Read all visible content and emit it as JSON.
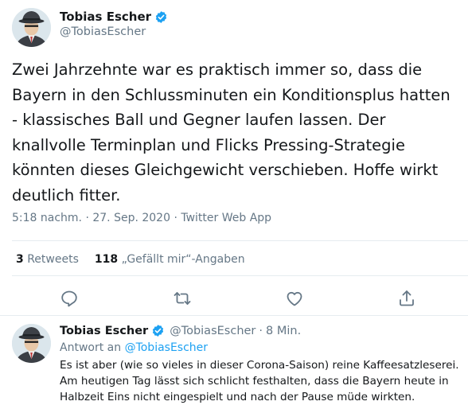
{
  "main_tweet": {
    "display_name": "Tobias Escher",
    "handle": "@TobiasEscher",
    "text": "Zwei Jahrzehnte war es praktisch immer so, dass die Bayern in den Schlussminuten ein Konditionsplus hatten - klassisches Ball und Gegner laufen lassen. Der knallvolle Terminplan und Flicks Pressing-Strategie könnten dieses Gleichgewicht verschieben. Hoffe wirkt deutlich fitter.",
    "time": "5:18 nachm.",
    "date": "27. Sep. 2020",
    "source": "Twitter Web App",
    "separator": "·",
    "retweets_count": "3",
    "retweets_label": "Retweets",
    "likes_count": "118",
    "likes_label": "„Gefällt mir“-Angaben"
  },
  "reply_tweet": {
    "display_name": "Tobias Escher",
    "handle": "@TobiasEscher",
    "separator": "·",
    "time": "8 Min.",
    "reply_prefix": "Antwort an",
    "reply_handle": "@TobiasEscher",
    "text": "Es ist aber (wie so vieles in dieser Corona-Saison) reine Kaffeesatzleserei. Am heutigen Tag lässt sich schlicht festhalten, dass die Bayern heute in Halbzeit Eins nicht eingespielt und nach der Pause müde wirkten."
  },
  "icons": {
    "verified": "verified-badge-icon",
    "reply": "reply-icon",
    "retweet": "retweet-icon",
    "like": "like-icon",
    "share": "share-icon"
  },
  "colors": {
    "accent": "#1da1f2",
    "muted": "#657786",
    "text": "#14171a",
    "border": "#e6ecf0"
  }
}
